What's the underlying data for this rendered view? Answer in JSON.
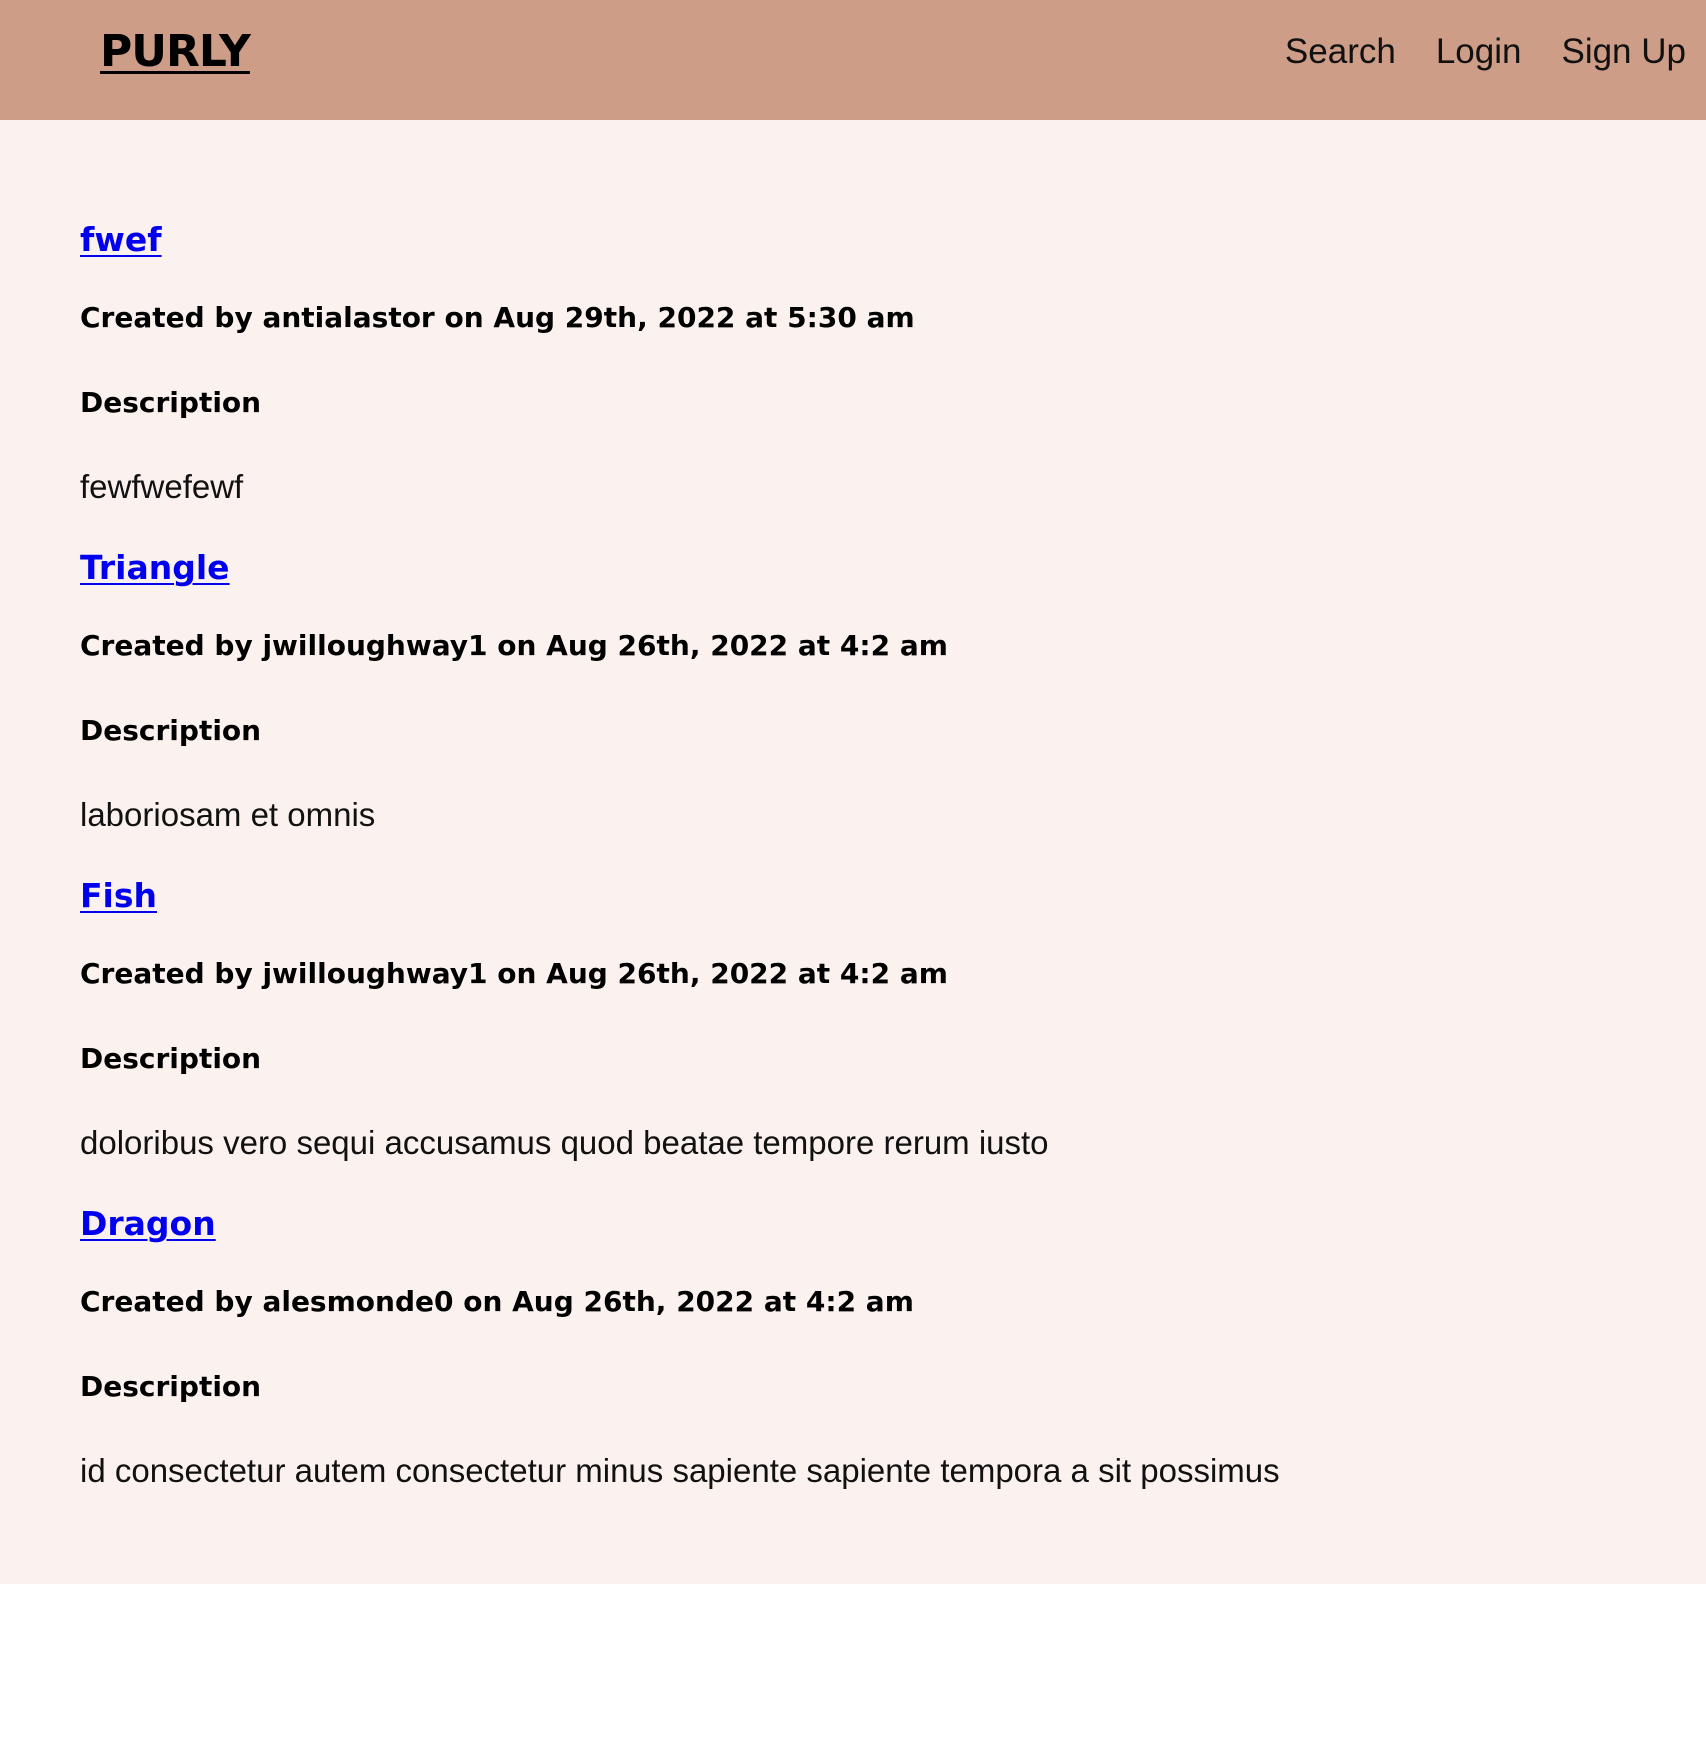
{
  "header": {
    "logo": "PURLY",
    "nav": {
      "search": "Search",
      "login": "Login",
      "signup": "Sign Up"
    }
  },
  "posts": [
    {
      "title": "fwef",
      "meta": "Created by antialastor on Aug 29th, 2022 at 5:30 am",
      "desc_label": "Description",
      "description": "fewfwefewf"
    },
    {
      "title": "Triangle",
      "meta": "Created by jwilloughway1 on Aug 26th, 2022 at 4:2 am",
      "desc_label": "Description",
      "description": "laboriosam et omnis"
    },
    {
      "title": "Fish",
      "meta": "Created by jwilloughway1 on Aug 26th, 2022 at 4:2 am",
      "desc_label": "Description",
      "description": "doloribus vero sequi accusamus quod beatae tempore rerum iusto"
    },
    {
      "title": "Dragon",
      "meta": "Created by alesmonde0 on Aug 26th, 2022 at 4:2 am",
      "desc_label": "Description",
      "description": "id consectetur autem consectetur minus sapiente sapiente tempora a sit possimus"
    }
  ],
  "colors": {
    "navbar_bg": "#cd9d88",
    "page_bg": "#fbf1ee",
    "link": "#0000ee"
  }
}
